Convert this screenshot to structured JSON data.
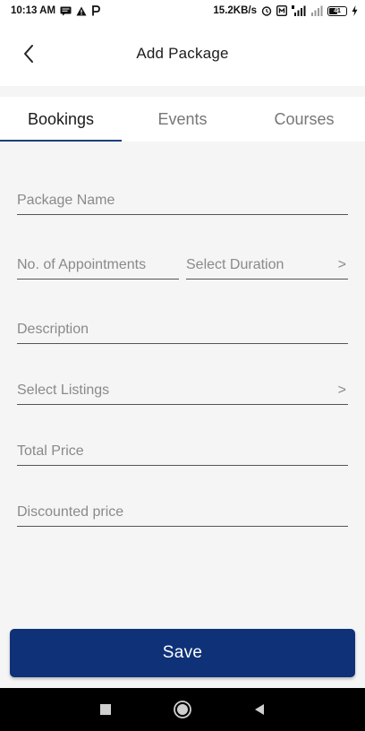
{
  "status_bar": {
    "time": "10:13 AM",
    "left_icons": [
      "message-icon",
      "warning-icon",
      "paytm-icon"
    ],
    "network_speed": "15.2KB/s",
    "right_icons": [
      "alarm-icon",
      "data-icon",
      "signal-icon",
      "signal-icon-2",
      "battery-icon"
    ],
    "battery_level": "41"
  },
  "app_bar": {
    "title": "Add Package",
    "back_icon": "chevron-left-icon"
  },
  "tabs": [
    {
      "label": "Bookings",
      "active": true
    },
    {
      "label": "Events",
      "active": false
    },
    {
      "label": "Courses",
      "active": false
    }
  ],
  "form": {
    "package_name": "Package Name",
    "appointments": "No. of Appointments",
    "duration": "Select Duration",
    "description": "Description",
    "listings": "Select Listings",
    "total_price": "Total Price",
    "discounted_price": "Discounted price",
    "chevron": ">"
  },
  "save_label": "Save",
  "colors": {
    "accent": "#0e3178",
    "tab_indicator": "#1c3f7a",
    "background": "#f5f5f6"
  },
  "nav_bar": {
    "icons": [
      "square-icon",
      "circle-icon",
      "triangle-back-icon"
    ]
  }
}
